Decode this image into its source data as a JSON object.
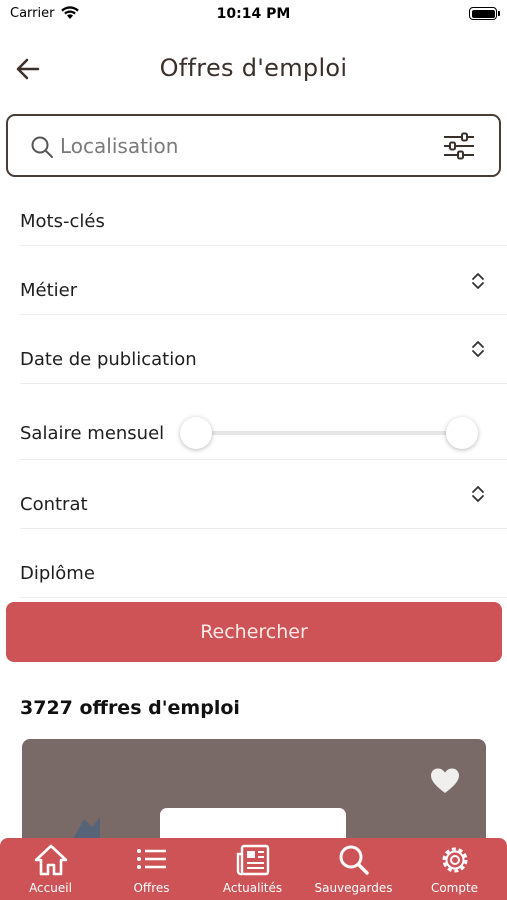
{
  "status_bar": {
    "carrier": "Carrier",
    "time": "10:14 PM"
  },
  "header": {
    "title": "Offres d'emploi"
  },
  "search": {
    "placeholder": "Localisation"
  },
  "fields": {
    "keywords": "Mots-clés",
    "job": "Métier",
    "publication_date": "Date de publication",
    "salary": "Salaire mensuel",
    "contract": "Contrat",
    "diploma": "Diplôme"
  },
  "salary_range": {
    "min_fraction": 0,
    "max_fraction": 1
  },
  "search_button": "Rechercher",
  "results": {
    "count_label": "3727 offres d'emploi"
  },
  "tabs": [
    {
      "label": "Accueil",
      "icon": "home-icon"
    },
    {
      "label": "Offres",
      "icon": "list-icon"
    },
    {
      "label": "Actualités",
      "icon": "newspaper-icon"
    },
    {
      "label": "Sauvegardes",
      "icon": "search-icon"
    },
    {
      "label": "Compte",
      "icon": "gear-icon"
    }
  ],
  "colors": {
    "accent": "#cd5356",
    "card": "#796a67",
    "title": "#3b2f2a"
  }
}
